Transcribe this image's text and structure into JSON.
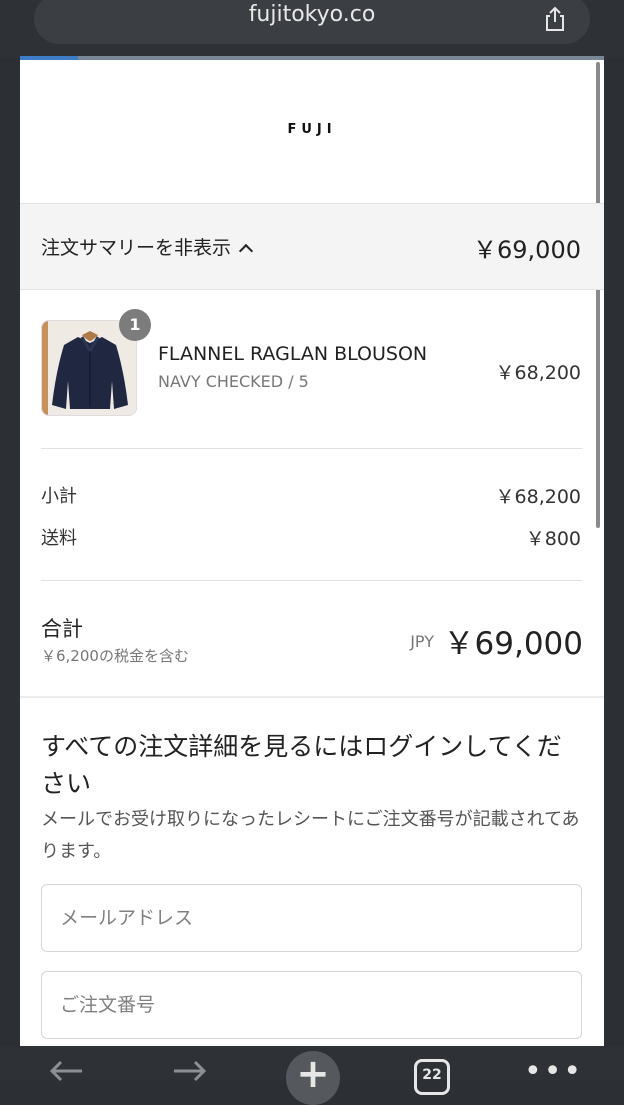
{
  "browser": {
    "url": "fujitokyo.co",
    "load_progress": 0.1,
    "tab_count": "22"
  },
  "store": {
    "logo": "FUJI"
  },
  "summary": {
    "toggle_label": "注文サマリーを非表示",
    "total": "￥69,000"
  },
  "line_item": {
    "quantity": "1",
    "name": "FLANNEL RAGLAN BLOUSON",
    "variant": "NAVY CHECKED / 5",
    "price": "￥68,200"
  },
  "costs": {
    "subtotal_label": "小計",
    "subtotal_value": "￥68,200",
    "shipping_label": "送料",
    "shipping_value": "￥800"
  },
  "total": {
    "label": "合計",
    "tax_note": "￥6,200の税金を含む",
    "currency": "JPY",
    "amount": "￥69,000"
  },
  "login": {
    "heading": "すべての注文詳細を見るにはログインしてください",
    "description": "メールでお受け取りになったレシートにご注文番号が記載されてあります。",
    "email_placeholder": "メールアドレス",
    "order_placeholder": "ご注文番号"
  },
  "colors": {
    "browser_chrome": "#2e3236",
    "progress_accent": "#3d7dc8",
    "summary_bg": "#f4f4f4",
    "badge": "#7c7c7c"
  },
  "icons": [
    "share-icon",
    "chevron-up-icon",
    "back-arrow-icon",
    "forward-arrow-icon",
    "plus-icon",
    "tabs-icon",
    "more-icon"
  ]
}
